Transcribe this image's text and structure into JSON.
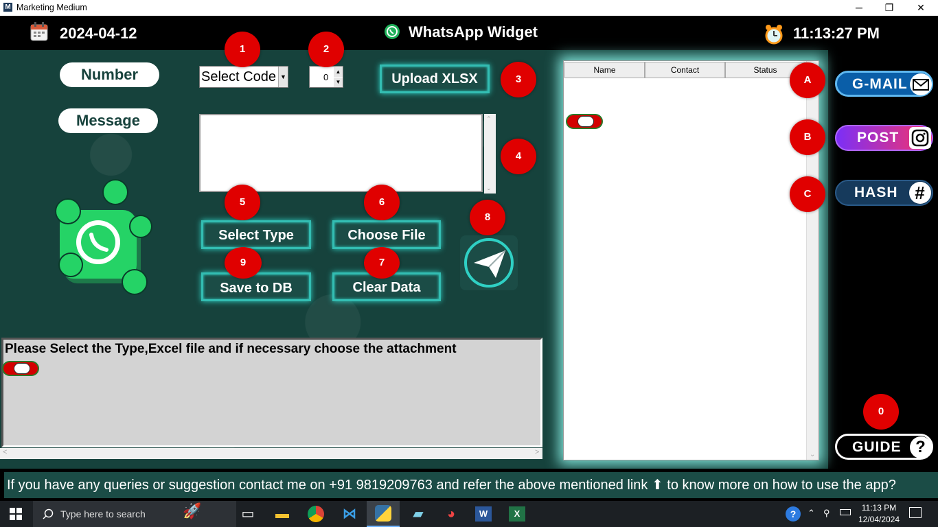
{
  "window": {
    "title": "Marketing Medium",
    "minimize_glyph": "─",
    "restore_glyph": "❐",
    "close_glyph": "✕"
  },
  "header": {
    "date": "2024-04-12",
    "app_title": "WhatsApp Widget",
    "time": "11:13:27 PM"
  },
  "form": {
    "number_label": "Number",
    "message_label": "Message",
    "country_code_value": "Select Code",
    "spin_value": "0",
    "upload_label": "Upload XLSX",
    "select_type_label": "Select Type",
    "choose_file_label": "Choose File",
    "save_db_label": "Save to DB",
    "clear_data_label": "Clear Data",
    "message_value": ""
  },
  "badges": {
    "b1": "1",
    "b2": "2",
    "b3": "3",
    "b4": "4",
    "b5": "5",
    "b6": "6",
    "b7": "7",
    "b8": "8",
    "b9": "9",
    "bA": "A",
    "bB": "B",
    "bC": "C",
    "b0": "0"
  },
  "status": {
    "message": "Please Select the Type,Excel file and if necessary choose the attachment"
  },
  "table": {
    "columns": [
      "Name",
      "Contact",
      "Status"
    ],
    "rows": []
  },
  "side": {
    "gmail_label": "G-MAIL",
    "post_label": "POST",
    "hash_label": "HASH",
    "guide_label": "GUIDE",
    "hash_glyph": "#",
    "guide_glyph": "?"
  },
  "footer": {
    "text": "If you have any queries or suggestion contact me on +91 9819209763 and refer the above mentioned link ⬆ to know more on how to use the app?"
  },
  "taskbar": {
    "search_placeholder": "Type here to search",
    "clock_time": "11:13 PM",
    "clock_date": "12/04/2024"
  },
  "colors": {
    "panel_bg": "#16423c",
    "accent_teal": "#33bdb2",
    "badge_red": "#e00000",
    "gmail_blue": "#0a5ea8",
    "post_gradient_start": "#7b2ff7",
    "post_gradient_end": "#f7336a",
    "hash_navy": "#163a5c"
  }
}
